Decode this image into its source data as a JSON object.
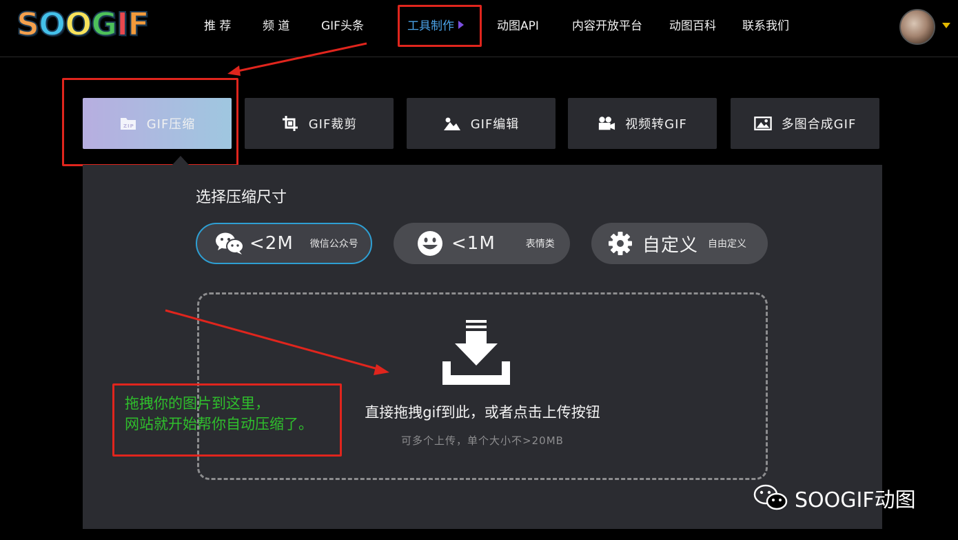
{
  "header": {
    "logo_text": "SOOGIF",
    "logo_letters": [
      "S",
      "O",
      "O",
      "G",
      "I",
      "F"
    ],
    "logo_colors": [
      "#f4a04d",
      "#44c1ea",
      "#f7e25b",
      "#4dc15a",
      "#e8484e",
      "#f29a3b"
    ],
    "nav": [
      {
        "label": "推 荐"
      },
      {
        "label": "频 道"
      },
      {
        "label": "GIF头条"
      },
      {
        "label": "工具制作"
      },
      {
        "label": "动图API"
      },
      {
        "label": "内容开放平台"
      },
      {
        "label": "动图百科"
      },
      {
        "label": "联系我们"
      }
    ],
    "active_nav_color": "#4ba3e8"
  },
  "tools": [
    {
      "label": "GIF压缩",
      "icon": "zip-file-icon",
      "icon_text": "ZIP"
    },
    {
      "label": "GIF裁剪",
      "icon": "crop-icon"
    },
    {
      "label": "GIF编辑",
      "icon": "image-edit-icon"
    },
    {
      "label": "视频转GIF",
      "icon": "video-camera-icon"
    },
    {
      "label": "多图合成GIF",
      "icon": "multi-image-icon"
    }
  ],
  "compress": {
    "title": "选择压缩尺寸",
    "options": [
      {
        "main": "<2M",
        "sub": "微信公众号",
        "icon": "wechat-icon"
      },
      {
        "main": "<1M",
        "sub": "表情类",
        "icon": "smiley-icon"
      },
      {
        "main": "自定义",
        "sub": "自由定义",
        "icon": "gear-icon"
      }
    ],
    "selected_color": "#2e9fd3"
  },
  "dropzone": {
    "main_text": "直接拖拽gif到此，或者点击上传按钮",
    "sub_text": "可多个上传，单个大小不>20MB",
    "icon": "upload-tray-icon"
  },
  "annotation": {
    "note": "拖拽你的图片到这里，\n网站就开始帮你自动压缩了。",
    "note_color": "#2fbf2c",
    "highlight_color": "#e0251d"
  },
  "watermark": {
    "text": "SOOGIF动图",
    "icon": "wechat-icon"
  }
}
